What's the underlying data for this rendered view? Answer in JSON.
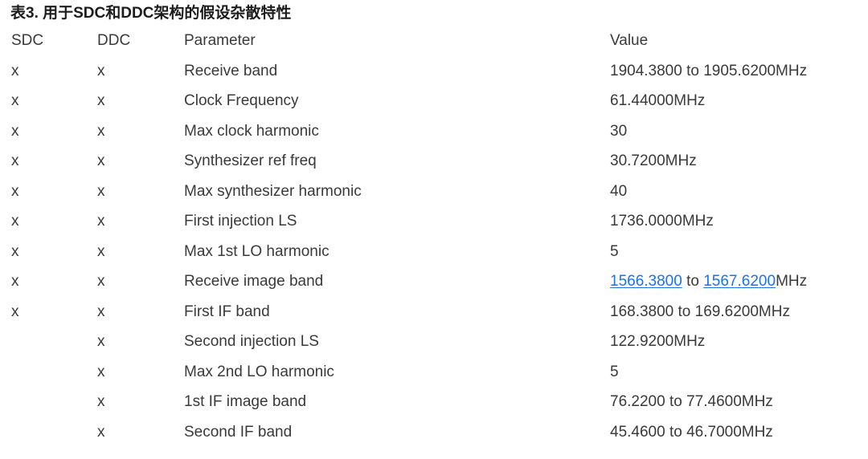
{
  "table": {
    "title": "表3. 用于SDC和DDC架构的假设杂散特性",
    "columns": {
      "sdc": "SDC",
      "ddc": "DDC",
      "parameter": "Parameter",
      "value": "Value"
    },
    "link_color": "#1a73e8",
    "text_color": "#3a3a3a",
    "mark": "x",
    "rows": [
      {
        "sdc": "x",
        "ddc": "x",
        "parameter": "Receive band",
        "value": "1904.3800 to 1905.6200MHz",
        "value_parts": [
          {
            "text": "1904.3800 to 1905.6200MHz",
            "link": false
          }
        ]
      },
      {
        "sdc": "x",
        "ddc": "x",
        "parameter": "Clock Frequency",
        "value": "61.44000MHz",
        "value_parts": [
          {
            "text": "61.44000MHz",
            "link": false
          }
        ]
      },
      {
        "sdc": "x",
        "ddc": "x",
        "parameter": "Max clock harmonic",
        "value": "30",
        "value_parts": [
          {
            "text": "30",
            "link": false
          }
        ]
      },
      {
        "sdc": "x",
        "ddc": "x",
        "parameter": "Synthesizer ref freq",
        "value": "30.7200MHz",
        "value_parts": [
          {
            "text": "30.7200MHz",
            "link": false
          }
        ]
      },
      {
        "sdc": "x",
        "ddc": "x",
        "parameter": "Max synthesizer harmonic",
        "value": "40",
        "value_parts": [
          {
            "text": "40",
            "link": false
          }
        ]
      },
      {
        "sdc": "x",
        "ddc": "x",
        "parameter": "First injection LS",
        "value": "1736.0000MHz",
        "value_parts": [
          {
            "text": "1736.0000MHz",
            "link": false
          }
        ]
      },
      {
        "sdc": "x",
        "ddc": "x",
        "parameter": "Max 1st LO harmonic",
        "value": "5",
        "value_parts": [
          {
            "text": "5",
            "link": false
          }
        ]
      },
      {
        "sdc": "x",
        "ddc": "x",
        "parameter": "Receive image band",
        "value": "1566.3800 to 1567.6200MHz",
        "value_parts": [
          {
            "text": "1566.3800",
            "link": true
          },
          {
            "text": " to ",
            "link": false
          },
          {
            "text": "1567.6200",
            "link": true
          },
          {
            "text": "MHz",
            "link": false
          }
        ]
      },
      {
        "sdc": "x",
        "ddc": "x",
        "parameter": "First IF band",
        "value": "168.3800 to 169.6200MHz",
        "value_parts": [
          {
            "text": "168.3800 to 169.6200MHz",
            "link": false
          }
        ]
      },
      {
        "sdc": "",
        "ddc": "x",
        "parameter": "Second injection LS",
        "value": "122.9200MHz",
        "value_parts": [
          {
            "text": "122.9200MHz",
            "link": false
          }
        ]
      },
      {
        "sdc": "",
        "ddc": "x",
        "parameter": "Max 2nd LO harmonic",
        "value": "5",
        "value_parts": [
          {
            "text": "5",
            "link": false
          }
        ]
      },
      {
        "sdc": "",
        "ddc": "x",
        "parameter": "1st IF image band",
        "value": "76.2200 to 77.4600MHz",
        "value_parts": [
          {
            "text": "76.2200 to 77.4600MHz",
            "link": false
          }
        ]
      },
      {
        "sdc": "",
        "ddc": "x",
        "parameter": "Second IF band",
        "value": "45.4600 to 46.7000MHz",
        "value_parts": [
          {
            "text": "45.4600 to 46.7000MHz",
            "link": false
          }
        ]
      }
    ]
  }
}
